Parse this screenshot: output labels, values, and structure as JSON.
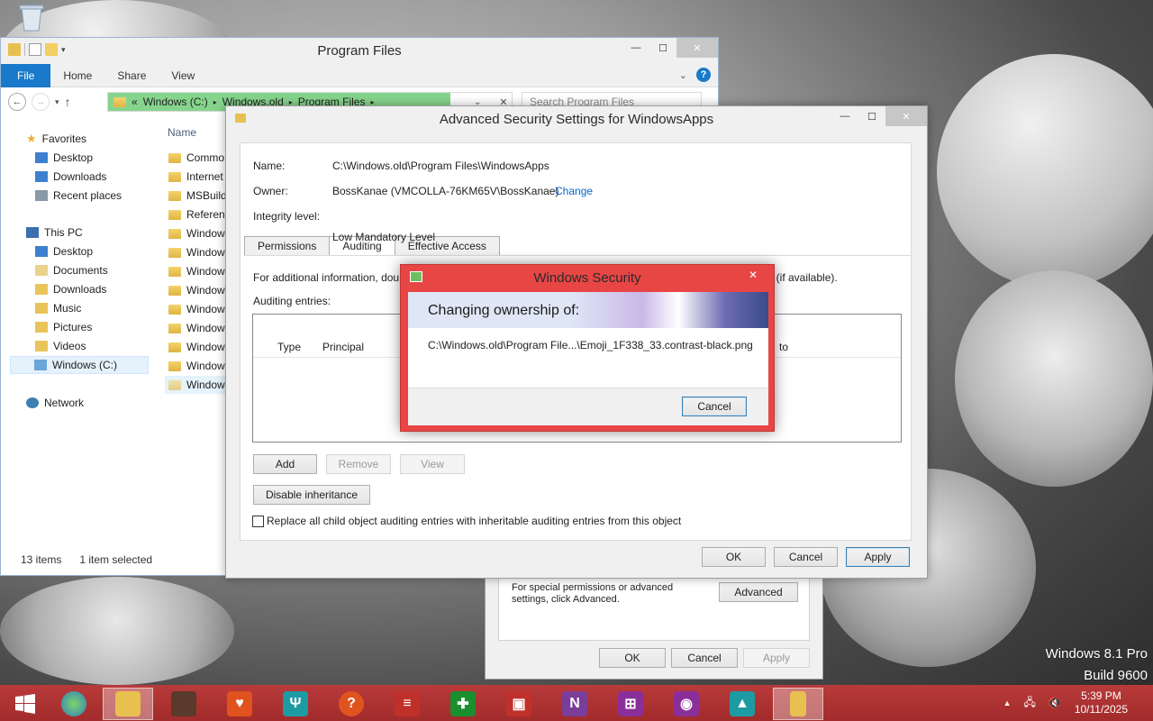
{
  "watermark": {
    "line1": "Windows 8.1 Pro",
    "line2": "Build 9600"
  },
  "explorer": {
    "title": "Program Files",
    "ribbon_tabs": [
      "File",
      "Home",
      "Share",
      "View"
    ],
    "address": {
      "segments": [
        "«",
        "Windows (C:)",
        "Windows.old",
        "Program Files"
      ]
    },
    "search_placeholder": "Search Program Files",
    "nav": {
      "favorites": "Favorites",
      "desktop": "Desktop",
      "downloads": "Downloads",
      "recent": "Recent places",
      "this_pc": "This PC",
      "pc_desktop": "Desktop",
      "documents": "Documents",
      "pc_downloads": "Downloads",
      "music": "Music",
      "pictures": "Pictures",
      "videos": "Videos",
      "drive": "Windows (C:)",
      "network": "Network"
    },
    "column_name": "Name",
    "files": [
      "Commo",
      "Internet",
      "MSBuild",
      "Referen",
      "Window",
      "Window",
      "Window",
      "Window",
      "Window",
      "Window",
      "Window",
      "Window",
      "Window"
    ],
    "status_items": "13 items",
    "status_selected": "1 item selected"
  },
  "properties": {
    "advanced_text": "For special permissions or advanced settings, click Advanced.",
    "advanced_button": "Advanced",
    "ok": "OK",
    "cancel": "Cancel",
    "apply": "Apply"
  },
  "advanced": {
    "title": "Advanced Security Settings for WindowsApps",
    "name_label": "Name:",
    "name_value": "C:\\Windows.old\\Program Files\\WindowsApps",
    "owner_label": "Owner:",
    "owner_value": "BossKanae (VMCOLLA-76KM65V\\BossKanae)",
    "change_link": "Change",
    "integrity_label": "Integrity level:",
    "integrity_value": "Low Mandatory Level",
    "tabs": [
      "Permissions",
      "Auditing",
      "Effective Access"
    ],
    "info_text_left": "For additional information, dou",
    "info_text_right": "t (if available).",
    "entries_label": "Auditing entries:",
    "col_type": "Type",
    "col_principal": "Principal",
    "col_applies": "to",
    "add": "Add",
    "remove": "Remove",
    "view": "View",
    "disable_inheritance": "Disable inheritance",
    "replace_checkbox": "Replace all child object auditing entries with inheritable auditing entries from this object",
    "ok": "OK",
    "cancel": "Cancel",
    "apply": "Apply"
  },
  "security_dialog": {
    "title": "Windows Security",
    "heading": "Changing ownership of:",
    "path": "C:\\Windows.old\\Program File...\\Emoji_1F338_33.contrast-black.png",
    "cancel": "Cancel"
  },
  "taskbar": {
    "time": "5:39 PM",
    "date": "10/11/2025"
  },
  "colors": {
    "accent": "#1979ca",
    "taskbar": "#b03434",
    "dialog_frame": "#e84545",
    "address_progress": "#86d48c"
  }
}
